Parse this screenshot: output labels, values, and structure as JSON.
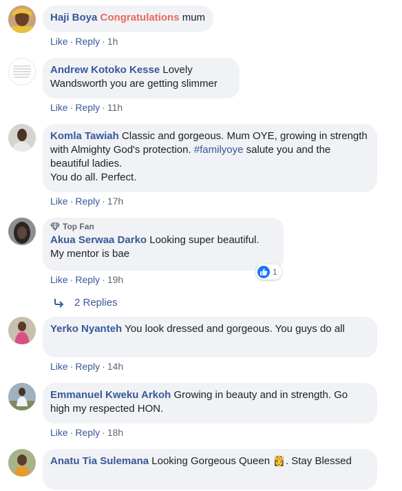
{
  "actions": {
    "like": "Like",
    "reply": "Reply",
    "sep": "·"
  },
  "comments": [
    {
      "author": "Haji Boya",
      "mention": "Congratulations",
      "text": " mum",
      "time": "1h"
    },
    {
      "author": "Andrew Kotoko Kesse",
      "text": "Lovely Wandsworth you are getting slimmer",
      "time": "11h"
    },
    {
      "author": "Komla Tawiah",
      "text_part1": "Classic and gorgeous. Mum OYE, growing in strength with Almighty God's protection. ",
      "hashtag": "#familyoye",
      "text_part2": " salute you and the beautiful ladies.",
      "text_line2": "You do all. Perfect.",
      "time": "17h"
    },
    {
      "badge": "Top Fan",
      "author": "Akua Serwaa Darko",
      "text": "Looking super beautiful.",
      "text_line2": "My mentor is bae",
      "time": "19h",
      "reaction_count": "1",
      "replies_label": "2 Replies"
    },
    {
      "author": "Yerko Nyanteh",
      "text": "You look dressed and gorgeous. You guys do all",
      "time": "14h"
    },
    {
      "author": "Emmanuel Kweku Arkoh",
      "text": "Growing in beauty and in strength. Go high my respected HON.",
      "time": "18h"
    },
    {
      "author": "Anatu Tia Sulemana",
      "text": "Looking Gorgeous Queen ",
      "emoji": "👸",
      "text_end": ". Stay Blessed"
    }
  ],
  "colors": {
    "link": "#385898",
    "mention": "#e9685f",
    "bubble": "#f0f2f5",
    "meta": "#606770",
    "like_badge": "#1877f2"
  }
}
